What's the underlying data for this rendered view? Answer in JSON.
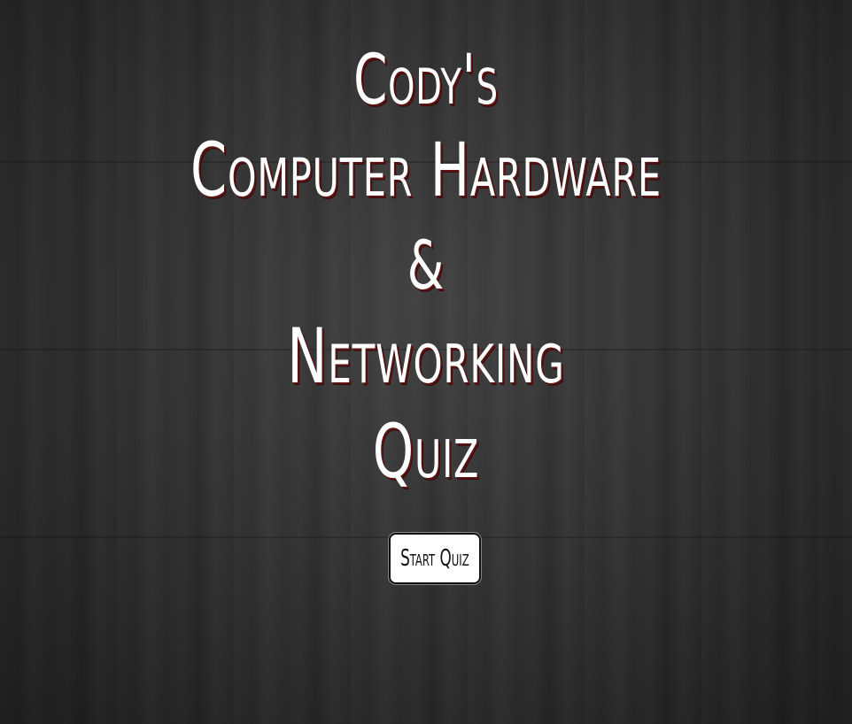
{
  "title": {
    "line1": "Cody's",
    "line2": "Computer Hardware",
    "line3": "&",
    "line4": "Networking",
    "line5": "Quiz"
  },
  "start_button": {
    "label": "Start Quiz"
  }
}
